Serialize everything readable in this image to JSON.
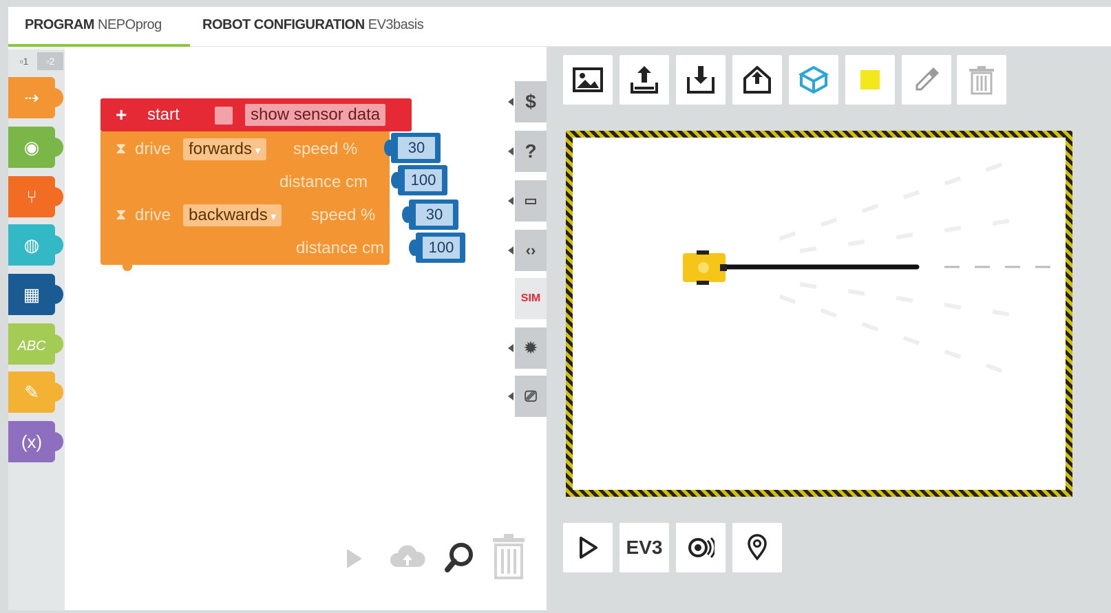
{
  "tabs": {
    "program_label": "PROGRAM",
    "program_name": "NEPOprog",
    "config_label": "ROBOT CONFIGURATION",
    "config_name": "EV3basis"
  },
  "toolbox": {
    "levels": [
      "1",
      "2"
    ],
    "categories": [
      {
        "icon": "action-icon",
        "color": "#f39533"
      },
      {
        "icon": "sensor-icon",
        "color": "#7ab648"
      },
      {
        "icon": "control-icon",
        "color": "#f26c23"
      },
      {
        "icon": "logic-icon",
        "color": "#33b8c5"
      },
      {
        "icon": "math-icon",
        "color": "#1b5b93"
      },
      {
        "icon": "text-icon",
        "color": "#a4cc55"
      },
      {
        "icon": "colour-icon",
        "color": "#f4b234"
      },
      {
        "icon": "variables-icon",
        "color": "#8e6fbf"
      }
    ]
  },
  "program": {
    "start_label": "start",
    "show_sensor_label": "show sensor data",
    "blocks": [
      {
        "label": "drive",
        "direction": "forwards",
        "speed_label": "speed %",
        "speed": "30",
        "distance_label": "distance cm",
        "distance": "100"
      },
      {
        "label": "drive",
        "direction": "backwards",
        "speed_label": "speed %",
        "speed": "30",
        "distance_label": "distance cm",
        "distance": "100"
      }
    ]
  },
  "sidetabs": {
    "sim_label": "SIM",
    "help_label": "?",
    "dollar_label": "$"
  },
  "sim": {
    "bottom_ev3_label": "EV3",
    "colors": {
      "robot": "#f5c518",
      "yellow_square": "#f3e81c",
      "blue_cube": "#2aa7d8"
    }
  }
}
